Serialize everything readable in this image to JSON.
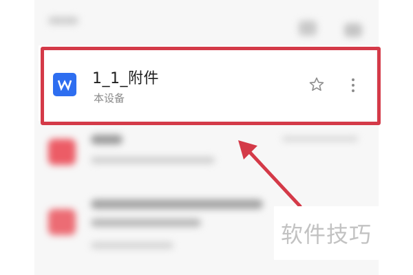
{
  "file_item": {
    "name": "1_1_附件",
    "location": "本设备",
    "icon_letter": "W",
    "icon_color": "#2e6ef0"
  },
  "annotation": {
    "highlight_color": "#d43a48"
  },
  "watermark": {
    "text": "软件技巧"
  },
  "icons": [
    "word-file-icon",
    "star-icon",
    "more-options-icon"
  ]
}
